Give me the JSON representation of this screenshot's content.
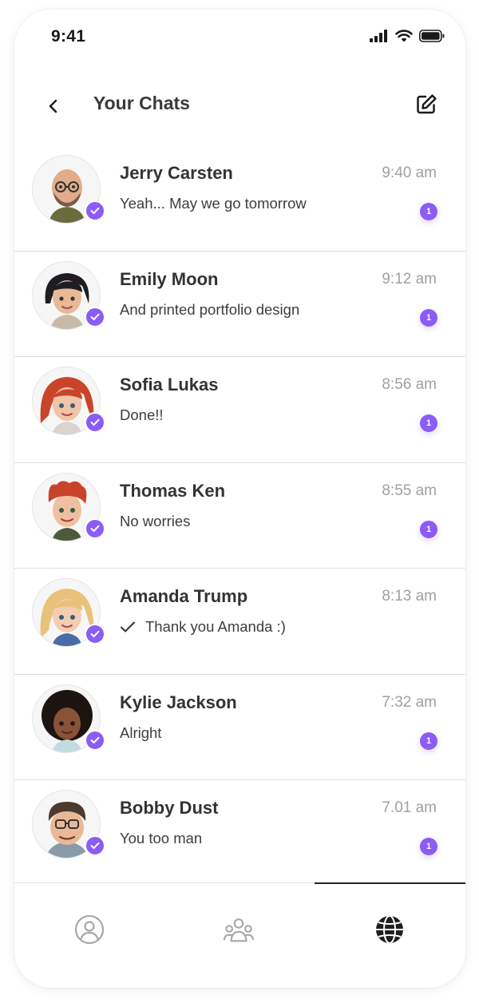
{
  "status_bar": {
    "time": "9:41"
  },
  "header": {
    "title": "Your Chats"
  },
  "chats": [
    {
      "name": "Jerry Carsten",
      "time": "9:40 am",
      "message": "Yeah... May we go tomorrow",
      "unread": "1",
      "read_receipt": false
    },
    {
      "name": "Emily Moon",
      "time": "9:12 am",
      "message": "And printed portfolio design",
      "unread": "1",
      "read_receipt": false
    },
    {
      "name": "Sofia Lukas",
      "time": "8:56 am",
      "message": "Done!!",
      "unread": "1",
      "read_receipt": false
    },
    {
      "name": "Thomas Ken",
      "time": "8:55 am",
      "message": "No worries",
      "unread": "1",
      "read_receipt": false
    },
    {
      "name": "Amanda Trump",
      "time": "8:13 am",
      "message": "Thank you Amanda :)",
      "unread": "",
      "read_receipt": true
    },
    {
      "name": "Kylie Jackson",
      "time": "7:32 am",
      "message": "Alright",
      "unread": "1",
      "read_receipt": false
    },
    {
      "name": "Bobby Dust",
      "time": "7.01 am",
      "message": "You too man",
      "unread": "1",
      "read_receipt": false
    }
  ],
  "nav": {
    "items": [
      {
        "icon": "profile-icon",
        "active": false
      },
      {
        "icon": "community-icon",
        "active": false
      },
      {
        "icon": "globe-icon",
        "active": true
      }
    ]
  },
  "colors": {
    "accent": "#8b5cf6",
    "divider": "#d9dde3",
    "time_gray": "#a0a0a0"
  }
}
